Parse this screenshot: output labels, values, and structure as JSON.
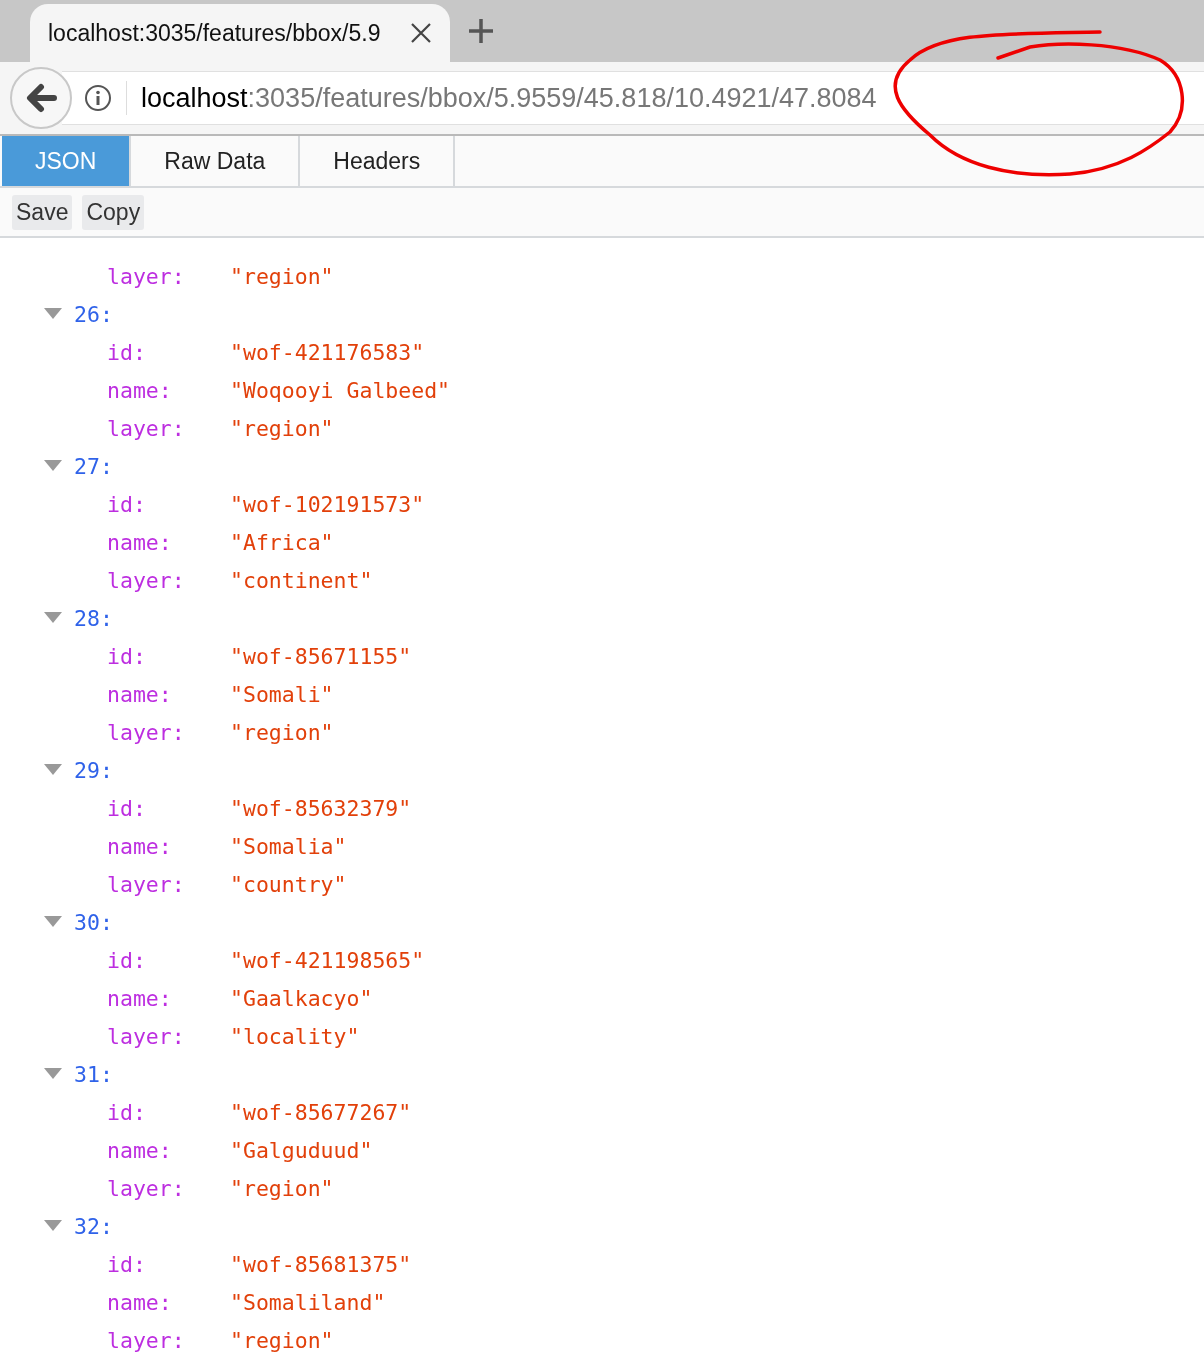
{
  "browser_tab": {
    "title": "localhost:3035/features/bbox/5.9",
    "selected": true
  },
  "address_bar": {
    "host": "localhost",
    "path": ":3035/features/bbox/5.9559/45.818/10.4921/47.8084"
  },
  "viewer_tabs": [
    {
      "label": "JSON",
      "selected": true
    },
    {
      "label": "Raw Data",
      "selected": false
    },
    {
      "label": "Headers",
      "selected": false
    }
  ],
  "toolbar_buttons": [
    "Save",
    "Copy"
  ],
  "partial_entry": {
    "fields": [
      {
        "key": "layer:",
        "value": "\"region\""
      }
    ]
  },
  "entries": [
    {
      "index": "26:",
      "expanded": true,
      "fields": [
        {
          "key": "id:",
          "value": "\"wof-421176583\""
        },
        {
          "key": "name:",
          "value": "\"Woqooyi Galbeed\""
        },
        {
          "key": "layer:",
          "value": "\"region\""
        }
      ]
    },
    {
      "index": "27:",
      "expanded": true,
      "fields": [
        {
          "key": "id:",
          "value": "\"wof-102191573\""
        },
        {
          "key": "name:",
          "value": "\"Africa\""
        },
        {
          "key": "layer:",
          "value": "\"continent\""
        }
      ]
    },
    {
      "index": "28:",
      "expanded": true,
      "fields": [
        {
          "key": "id:",
          "value": "\"wof-85671155\""
        },
        {
          "key": "name:",
          "value": "\"Somali\""
        },
        {
          "key": "layer:",
          "value": "\"region\""
        }
      ]
    },
    {
      "index": "29:",
      "expanded": true,
      "fields": [
        {
          "key": "id:",
          "value": "\"wof-85632379\""
        },
        {
          "key": "name:",
          "value": "\"Somalia\""
        },
        {
          "key": "layer:",
          "value": "\"country\""
        }
      ]
    },
    {
      "index": "30:",
      "expanded": true,
      "fields": [
        {
          "key": "id:",
          "value": "\"wof-421198565\""
        },
        {
          "key": "name:",
          "value": "\"Gaalkacyo\""
        },
        {
          "key": "layer:",
          "value": "\"locality\""
        }
      ]
    },
    {
      "index": "31:",
      "expanded": true,
      "fields": [
        {
          "key": "id:",
          "value": "\"wof-85677267\""
        },
        {
          "key": "name:",
          "value": "\"Galguduud\""
        },
        {
          "key": "layer:",
          "value": "\"region\""
        }
      ]
    },
    {
      "index": "32:",
      "expanded": true,
      "fields": [
        {
          "key": "id:",
          "value": "\"wof-85681375\""
        },
        {
          "key": "name:",
          "value": "\"Somaliland\""
        },
        {
          "key": "layer:",
          "value": "\"region\""
        }
      ]
    }
  ]
}
